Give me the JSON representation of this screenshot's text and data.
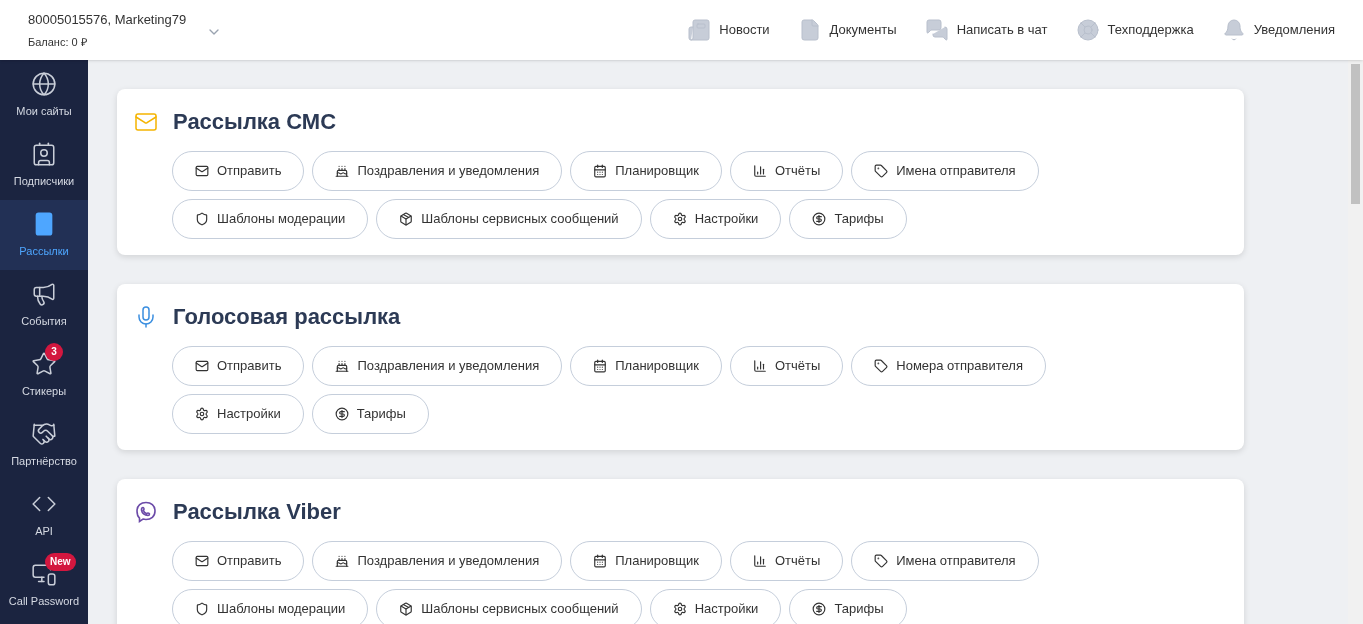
{
  "account": {
    "name": "80005015576, Marketing79",
    "balance": "Баланс: 0 ₽"
  },
  "top_nav": [
    {
      "kind": "news",
      "label": "Новости"
    },
    {
      "kind": "docs",
      "label": "Документы"
    },
    {
      "kind": "chat",
      "label": "Написать в чат"
    },
    {
      "kind": "support",
      "label": "Техподдержка"
    },
    {
      "kind": "bell",
      "label": "Уведомления"
    }
  ],
  "sidebar": {
    "items": [
      {
        "kind": "globe",
        "label": "Мои сайты",
        "selected": false
      },
      {
        "kind": "contact",
        "label": "Подписчики",
        "selected": false
      },
      {
        "kind": "phone",
        "label": "Рассылки",
        "selected": true
      },
      {
        "kind": "megaphone",
        "label": "События",
        "selected": false
      },
      {
        "kind": "star",
        "label": "Стикеры",
        "selected": false,
        "badge": "3"
      },
      {
        "kind": "handshake",
        "label": "Партнёрство",
        "selected": false
      },
      {
        "kind": "code",
        "label": "API",
        "selected": false
      },
      {
        "kind": "devices",
        "label": "Call Password",
        "selected": false,
        "badge": "New"
      }
    ]
  },
  "cards": [
    {
      "kind": "sms",
      "title": "Рассылка СМС",
      "actions": [
        {
          "kind": "send",
          "label": "Отправить"
        },
        {
          "kind": "cake",
          "label": "Поздравления и уведомления"
        },
        {
          "kind": "calendar",
          "label": "Планировщик"
        },
        {
          "kind": "chart",
          "label": "Отчёты"
        },
        {
          "kind": "tag",
          "label": "Имена отправителя"
        },
        {
          "kind": "shield",
          "label": "Шаблоны модерации"
        },
        {
          "kind": "box",
          "label": "Шаблоны сервисных сообщений"
        },
        {
          "kind": "gear",
          "label": "Настройки"
        },
        {
          "kind": "dollar",
          "label": "Тарифы"
        }
      ]
    },
    {
      "kind": "voice",
      "title": "Голосовая рассылка",
      "actions": [
        {
          "kind": "send",
          "label": "Отправить"
        },
        {
          "kind": "cake",
          "label": "Поздравления и уведомления"
        },
        {
          "kind": "calendar",
          "label": "Планировщик"
        },
        {
          "kind": "chart",
          "label": "Отчёты"
        },
        {
          "kind": "tag",
          "label": "Номера отправителя"
        },
        {
          "kind": "gear",
          "label": "Настройки"
        },
        {
          "kind": "dollar",
          "label": "Тарифы"
        }
      ]
    },
    {
      "kind": "viber",
      "title": "Рассылка Viber",
      "actions": [
        {
          "kind": "send",
          "label": "Отправить"
        },
        {
          "kind": "cake",
          "label": "Поздравления и уведомления"
        },
        {
          "kind": "calendar",
          "label": "Планировщик"
        },
        {
          "kind": "chart",
          "label": "Отчёты"
        },
        {
          "kind": "tag",
          "label": "Имена отправителя"
        },
        {
          "kind": "shield",
          "label": "Шаблоны модерации"
        },
        {
          "kind": "box",
          "label": "Шаблоны сервисных сообщений"
        },
        {
          "kind": "gear",
          "label": "Настройки"
        },
        {
          "kind": "dollar",
          "label": "Тарифы"
        }
      ]
    }
  ]
}
